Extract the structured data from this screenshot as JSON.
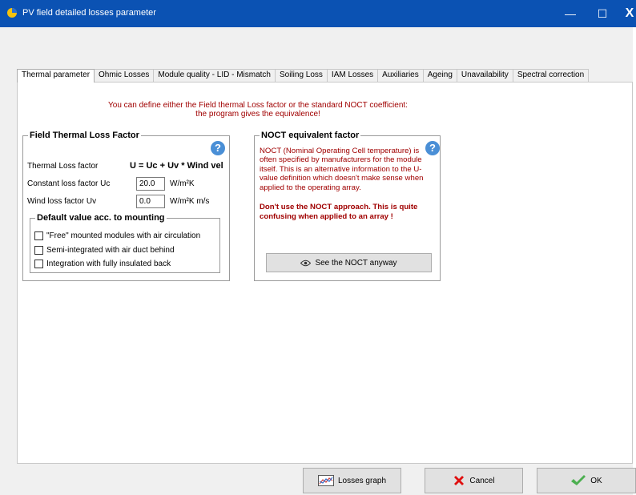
{
  "window": {
    "title": "PV field detailed losses parameter",
    "minimize_glyph": "—",
    "maximize_glyph": "☐",
    "close_glyph": "X",
    "accent": "#0b52b3"
  },
  "tabs": [
    {
      "label": "Thermal parameter",
      "active": true
    },
    {
      "label": "Ohmic Losses"
    },
    {
      "label": "Module quality - LID - Mismatch"
    },
    {
      "label": "Soiling Loss"
    },
    {
      "label": "IAM Losses"
    },
    {
      "label": "Auxiliaries"
    },
    {
      "label": "Ageing"
    },
    {
      "label": "Unavailability"
    },
    {
      "label": "Spectral correction"
    }
  ],
  "intro": {
    "line1": "You can define either the Field thermal Loss factor or the standard NOCT coefficient:",
    "line2": "the program gives the equivalence!",
    "color": "#a00000"
  },
  "field_thermal": {
    "title": "Field Thermal Loss Factor",
    "help_glyph": "?",
    "thermal_label": "Thermal Loss factor",
    "formula": "U = Uc + Uv * Wind vel",
    "uc_label": "Constant loss factor Uc",
    "uc_value": "20.0",
    "uc_unit": "W/m²K",
    "uv_label": "Wind loss factor Uv",
    "uv_value": "0.0",
    "uv_unit": "W/m²K m/s",
    "mounting": {
      "title": "Default value acc. to mounting",
      "options": [
        "\"Free\" mounted modules with air circulation",
        "Semi-integrated with air duct behind",
        "Integration with fully insulated back"
      ]
    }
  },
  "noct": {
    "title": "NOCT equivalent factor",
    "help_glyph": "?",
    "description": "NOCT (Nominal Operating Cell temperature) is often specified by manufacturers for the module itself. This is an alternative information to the U-value definition which doesn't make sense when applied to the operating array.",
    "warning": "Don't use the NOCT approach. This is quite confusing when applied to an array !",
    "button": "See the NOCT anyway"
  },
  "footer": {
    "losses_graph": "Losses graph",
    "cancel": "Cancel",
    "ok": "OK"
  }
}
